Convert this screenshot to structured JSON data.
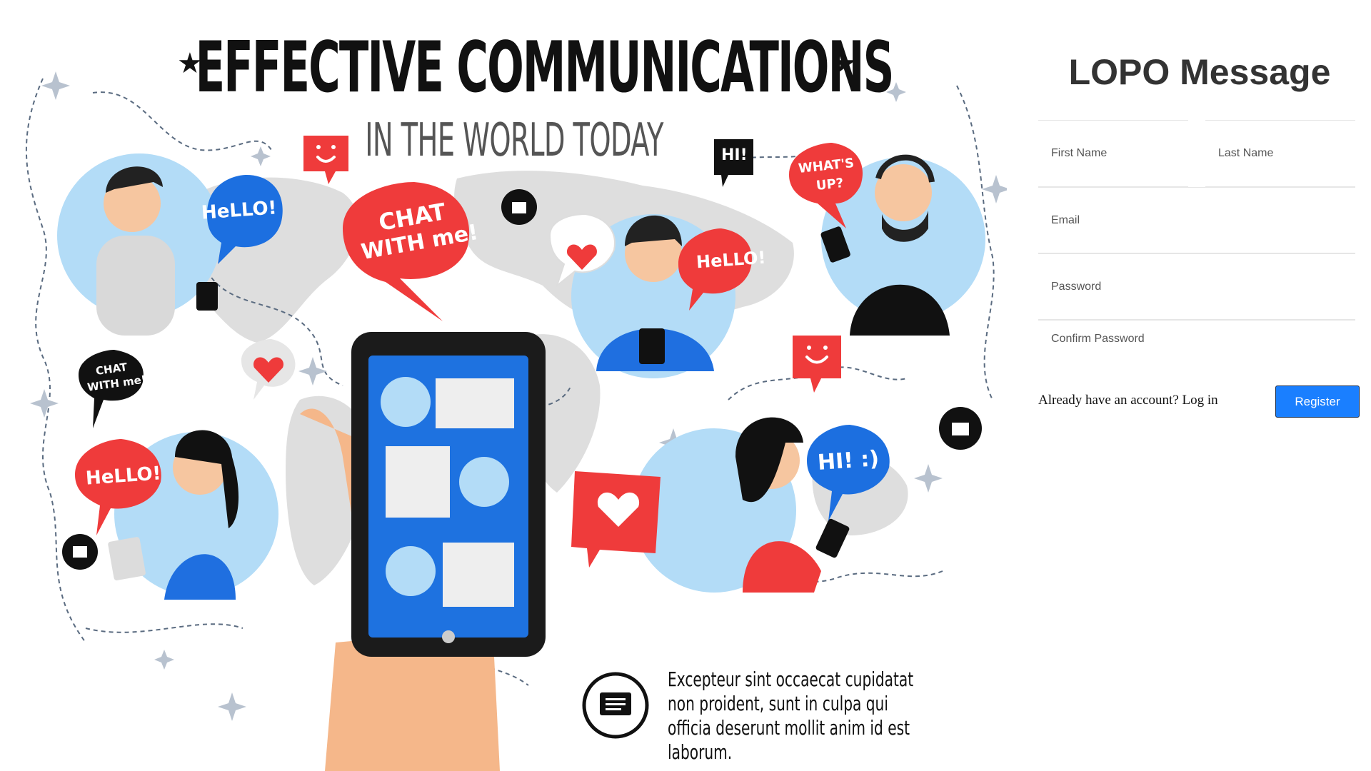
{
  "hero": {
    "title": "EFFECTIVE COMMUNICATIONS",
    "subtitle": "IN THE WORLD TODAY",
    "star_glyph": "★",
    "bubbles": {
      "hello_top_left": "HeLLO!",
      "chat_with_me_big_line1": "CHAT",
      "chat_with_me_big_line2": "WITH me!",
      "hi_small": "HI!",
      "whats_up_line1": "WHAT'S",
      "whats_up_line2": "UP?",
      "hello_center": "HeLLO!",
      "chat_with_me_small_line1": "CHAT",
      "chat_with_me_small_line2": "WITH me!",
      "hello_bottom_left": "HeLLO!",
      "hi_smile": "HI! :)"
    },
    "caption": "Excepteur sint occaecat cupidatat non proident, sunt in culpa qui officia deserunt mollit anim id est laborum.",
    "colors": {
      "accent_red": "#ef3b3b",
      "accent_blue": "#1c6fe0",
      "circle_blue": "#b3dcf7",
      "map_grey": "#dcdcdc"
    }
  },
  "form": {
    "brand": "LOPO Message",
    "first_name_placeholder": "First Name",
    "last_name_placeholder": "Last Name",
    "email_placeholder": "Email",
    "password_placeholder": "Password",
    "confirm_password_placeholder": "Confirm Password",
    "login_prompt": "Already have an account? Log in",
    "register_label": "Register",
    "colors": {
      "button": "#1a7fff",
      "brand_text": "#333333"
    }
  }
}
